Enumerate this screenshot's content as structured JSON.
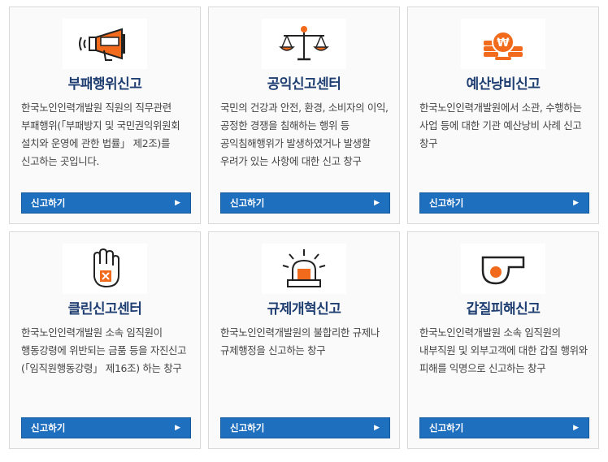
{
  "cards": [
    {
      "title": "부패행위신고",
      "desc": "한국노인인력개발원 직원의 직무관련 부패행위(「부패방지 및 국민권익위원회 설치와 운영에 관한 법률」 제2조)를 신고하는 곳입니다.",
      "button": "신고하기",
      "icon": "megaphone-icon"
    },
    {
      "title": "공익신고센터",
      "desc": "국민의 건강과 안전, 환경, 소비자의 이익, 공정한 경쟁을 침해하는 행위 등 공익침해행위가 발생하였거나 발생할 우려가 있는 사항에 대한 신고 창구",
      "button": "신고하기",
      "icon": "scales-icon"
    },
    {
      "title": "예산낭비신고",
      "desc": "한국노인인력개발원에서 소관, 수행하는 사업 등에 대한 기관 예산낭비 사례 신고 창구",
      "button": "신고하기",
      "icon": "coins-icon"
    },
    {
      "title": "클린신고센터",
      "desc": "한국노인인력개발원 소속 임직원이 행동강령에 위반되는 금품 등을 자진신고(「임직원행동강령」 제16조) 하는 창구",
      "button": "신고하기",
      "icon": "stop-hand-icon"
    },
    {
      "title": "규제개혁신고",
      "desc": "한국노인인력개발원의 불합리한 규제나 규제행정을 신고하는 창구",
      "button": "신고하기",
      "icon": "siren-icon"
    },
    {
      "title": "갑질피해신고",
      "desc": "한국노인인력개발원 소속 임직원의 내부직원 및 외부고객에 대한 갑질 행위와 피해를 익명으로 신고하는 창구",
      "button": "신고하기",
      "icon": "whistle-icon"
    }
  ],
  "colors": {
    "accent": "#f26a1b",
    "title": "#1f3f72",
    "button": "#1f6fbf"
  }
}
